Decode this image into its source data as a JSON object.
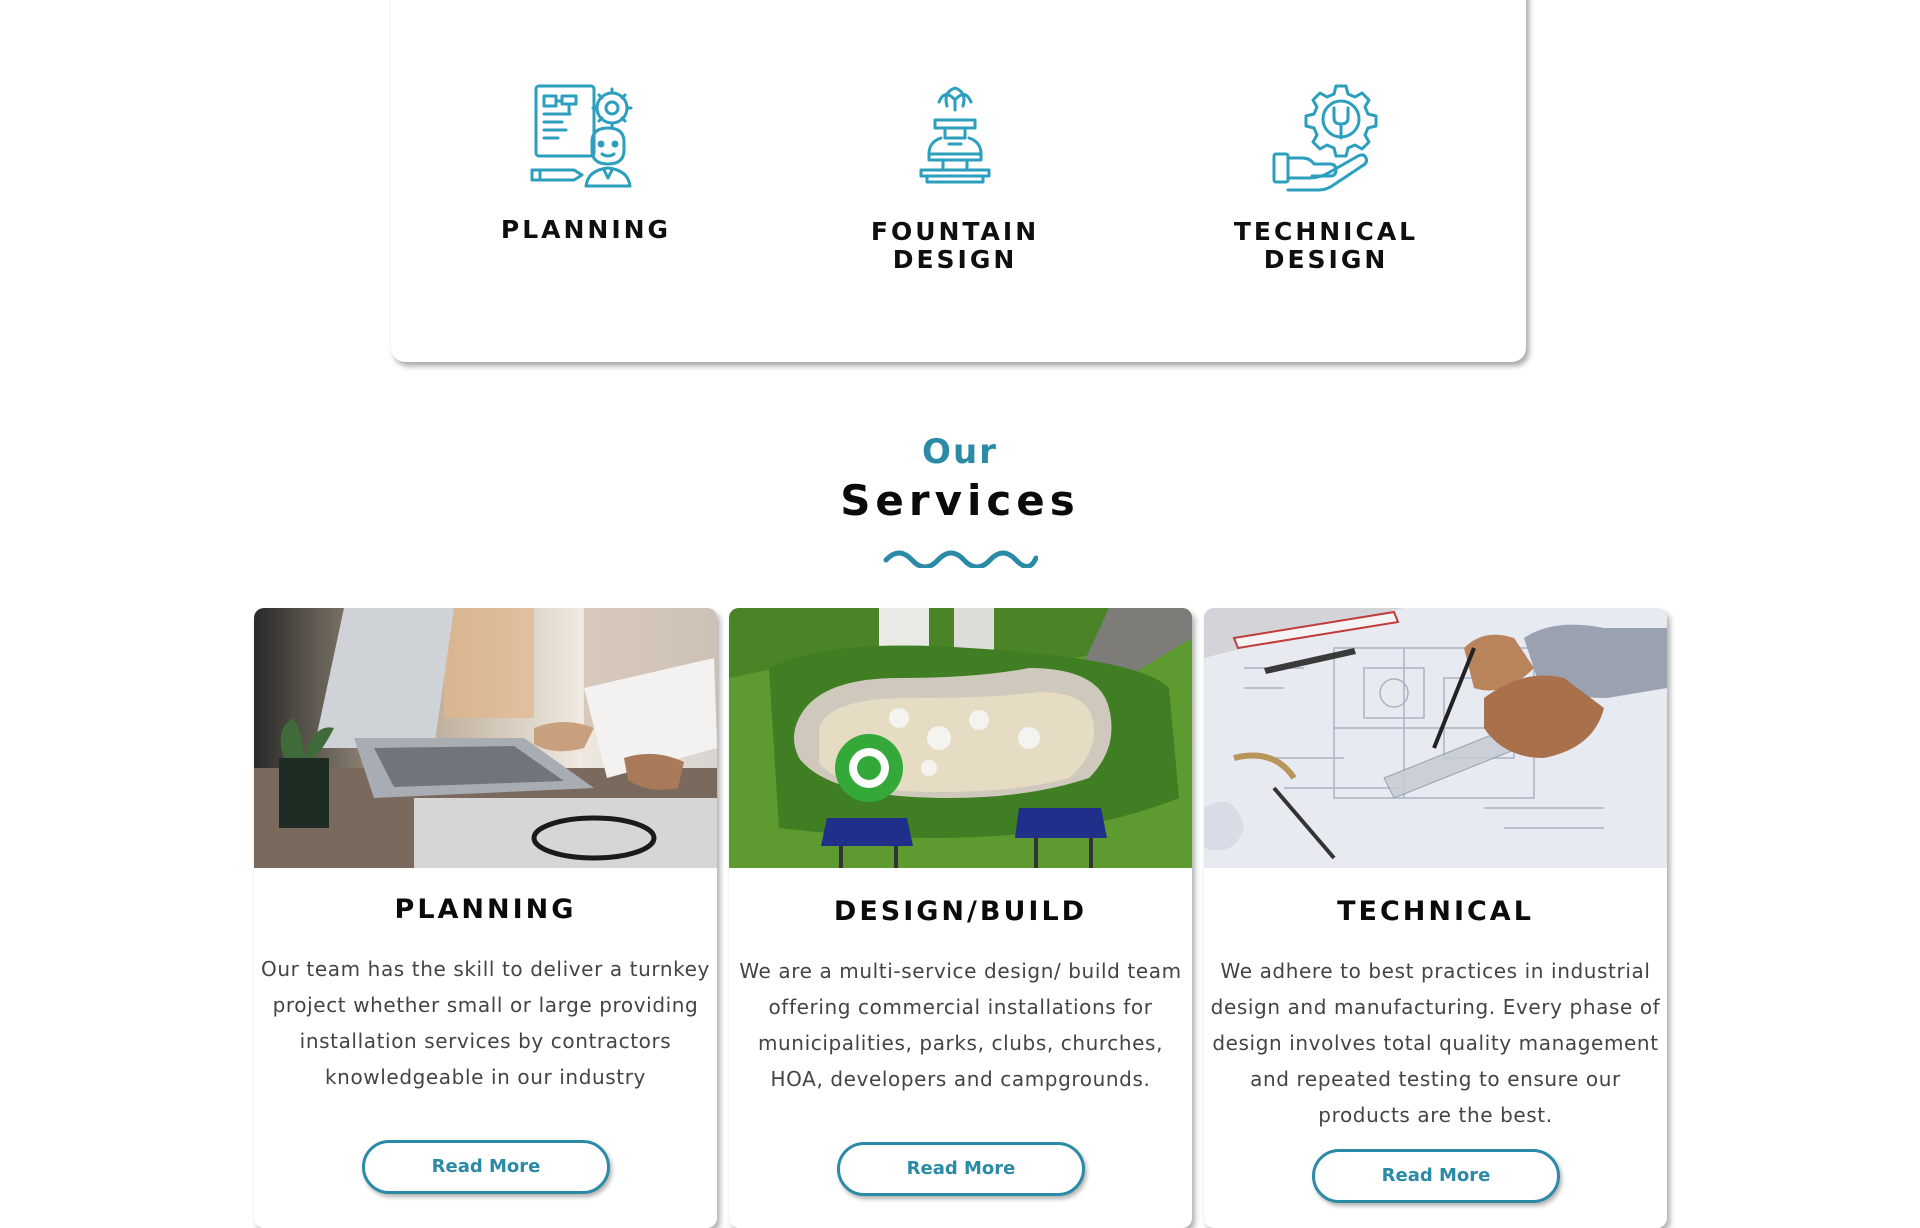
{
  "features": [
    {
      "label": "PLANNING",
      "icon": "planning-blueprint-icon"
    },
    {
      "label": "FOUNTAIN\nDESIGN",
      "icon": "fountain-icon"
    },
    {
      "label": "TECHNICAL\nDESIGN",
      "icon": "gear-wrench-hand-icon"
    }
  ],
  "section": {
    "eyebrow": "Our",
    "title": "Services"
  },
  "services": [
    {
      "title": "PLANNING",
      "description": "Our team has the skill to deliver a turnkey project whether small or large providing installation services by contractors knowledgeable in our industry",
      "button": "Read More",
      "image": "laptop-office-photo"
    },
    {
      "title": "DESIGN/BUILD",
      "description": "We are a multi-service design/ build team offering commercial installations for municipalities, parks, clubs, churches, HOA, developers and campgrounds.",
      "button": "Read More",
      "image": "splash-park-render"
    },
    {
      "title": "TECHNICAL",
      "description": "We adhere to best practices in industrial design and manufacturing. Every phase of design involves total quality management and repeated testing to ensure our products are the best.",
      "button": "Read More",
      "image": "blueprint-drafting-photo"
    }
  ],
  "colors": {
    "accent": "#2b8aa6",
    "text": "#0b0b0b",
    "body_text": "#444444"
  }
}
